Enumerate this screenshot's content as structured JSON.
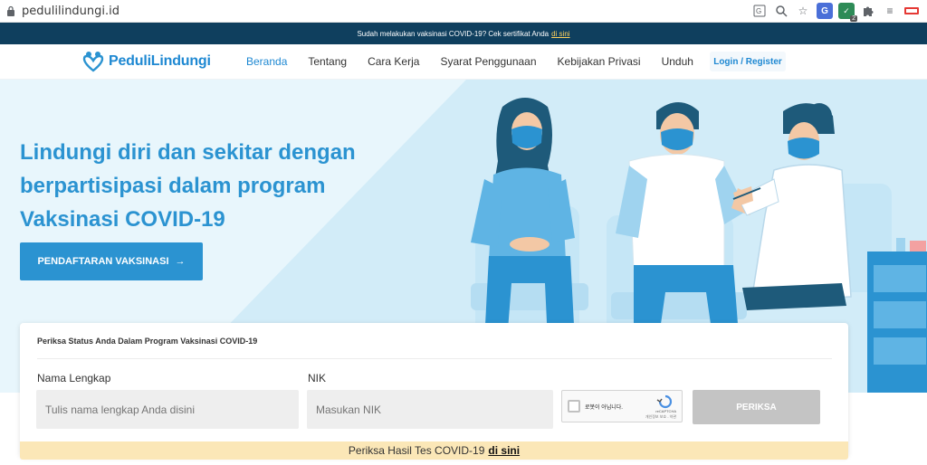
{
  "browser": {
    "url": "pedulilindungi.id",
    "ext_badge": "2"
  },
  "announcement": {
    "text": "Sudah melakukan vaksinasi COVID-19? Cek sertifikat Anda",
    "link": "di sini"
  },
  "nav": {
    "logo": "PeduliLindungi",
    "links": [
      "Beranda",
      "Tentang",
      "Cara Kerja",
      "Syarat Penggunaan",
      "Kebijakan Privasi",
      "Unduh"
    ],
    "login": "Login / Register"
  },
  "hero": {
    "title": "Lindungi diri dan sekitar dengan berpartisipasi dalam program Vaksinasi COVID-19",
    "cta": "PENDAFTARAN VAKSINASI"
  },
  "form": {
    "title": "Periksa Status Anda Dalam Program Vaksinasi COVID-19",
    "name_label": "Nama Lengkap",
    "name_placeholder": "Tulis nama lengkap Anda disini",
    "nik_label": "NIK",
    "nik_placeholder": "Masukan NIK",
    "captcha_text": "로봇이 아닙니다.",
    "captcha_brand": "reCAPTCHA",
    "captcha_privacy": "개인정보 보호 - 약관",
    "submit": "PERIKSA"
  },
  "result": {
    "text": "Periksa Hasil Tes COVID-19",
    "link": "di sini"
  },
  "colors": {
    "brand_blue": "#2b93d1",
    "banner_navy": "#0f3f5e",
    "hero_bg": "#d9eff9",
    "result_bg": "#fbe7b7"
  }
}
